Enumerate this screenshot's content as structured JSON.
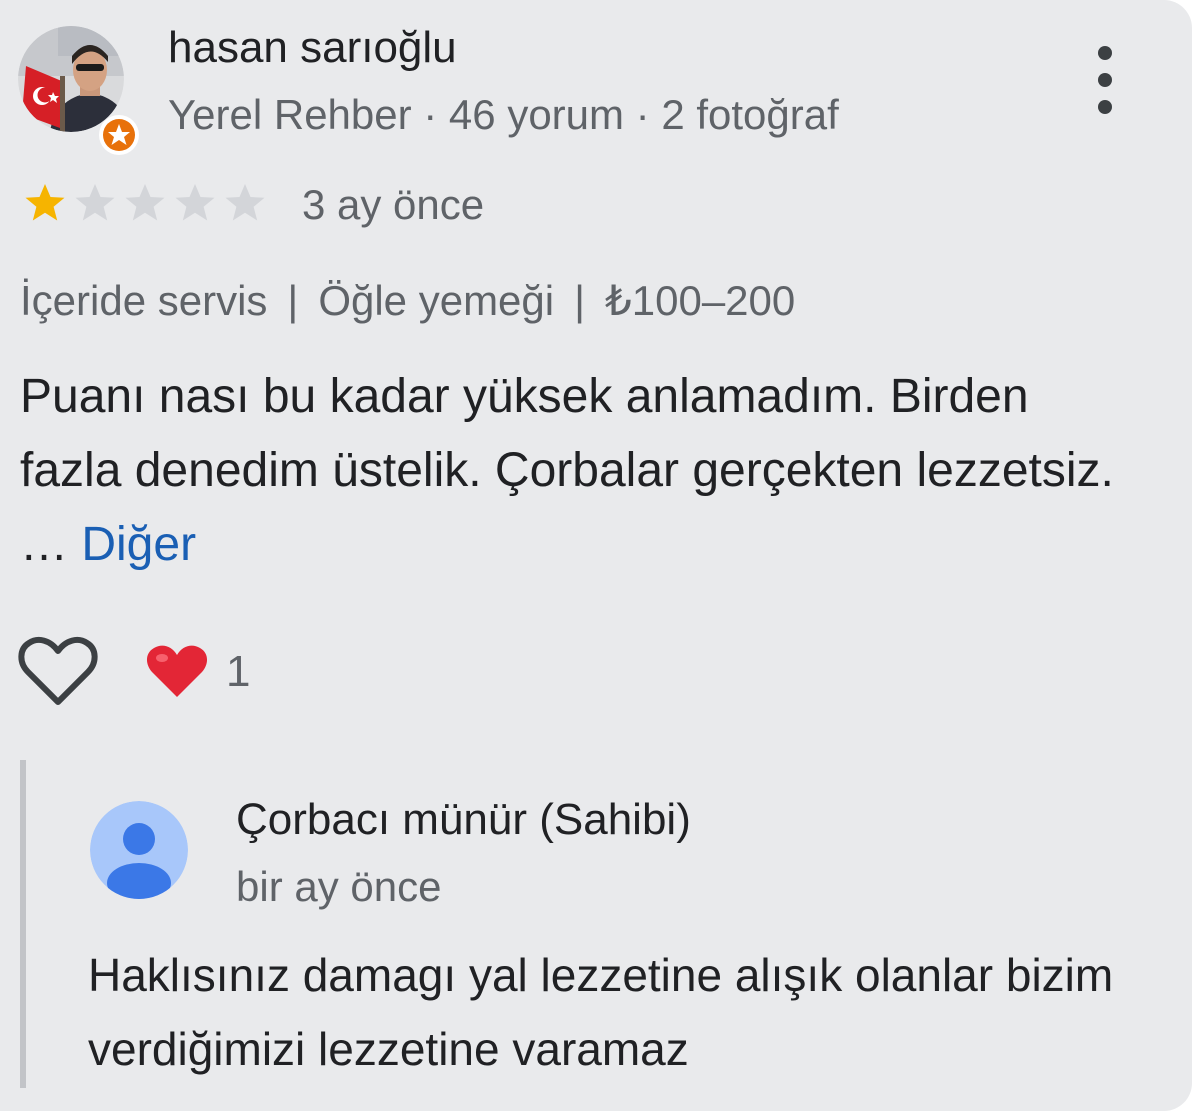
{
  "review": {
    "author": {
      "name": "hasan sarıoğlu",
      "meta": "Yerel Rehber · 46 yorum · 2 fotoğraf",
      "avatar_icon": "user-photo-with-flag",
      "badge_icon": "local-guide-star-badge",
      "badge_color": "#e8710a"
    },
    "menu_icon": "more-vertical-icon",
    "rating": {
      "value": 1,
      "max": 5,
      "filled_color": "#f6b400",
      "empty_color": "#d3d5d9"
    },
    "time": "3 ay önce",
    "tags": {
      "service": "İçeride servis",
      "separator": "|",
      "meal": "Öğle yemeği",
      "price": "₺100–200"
    },
    "text": "Puanı nası bu kadar yüksek anlamadım. Birden fazla denedim üstelik. Çorbalar gerçekten lezzetsiz. … ",
    "more_label": "Diğer",
    "like_icon": "heart-outline-icon",
    "reaction": {
      "icon": "red-heart-emoji",
      "count": "1",
      "color": "#e32636"
    }
  },
  "reply": {
    "author": "Çorbacı münür (Sahibi)",
    "avatar_icon": "default-person-avatar",
    "avatar_colors": {
      "background": "#a8c7fa",
      "figure": "#3b78e7"
    },
    "time": "bir ay önce",
    "text": "Haklısınız damagı yal lezzetine alışık olanlar bizim verdiğimizi lezzetine varamaz"
  }
}
